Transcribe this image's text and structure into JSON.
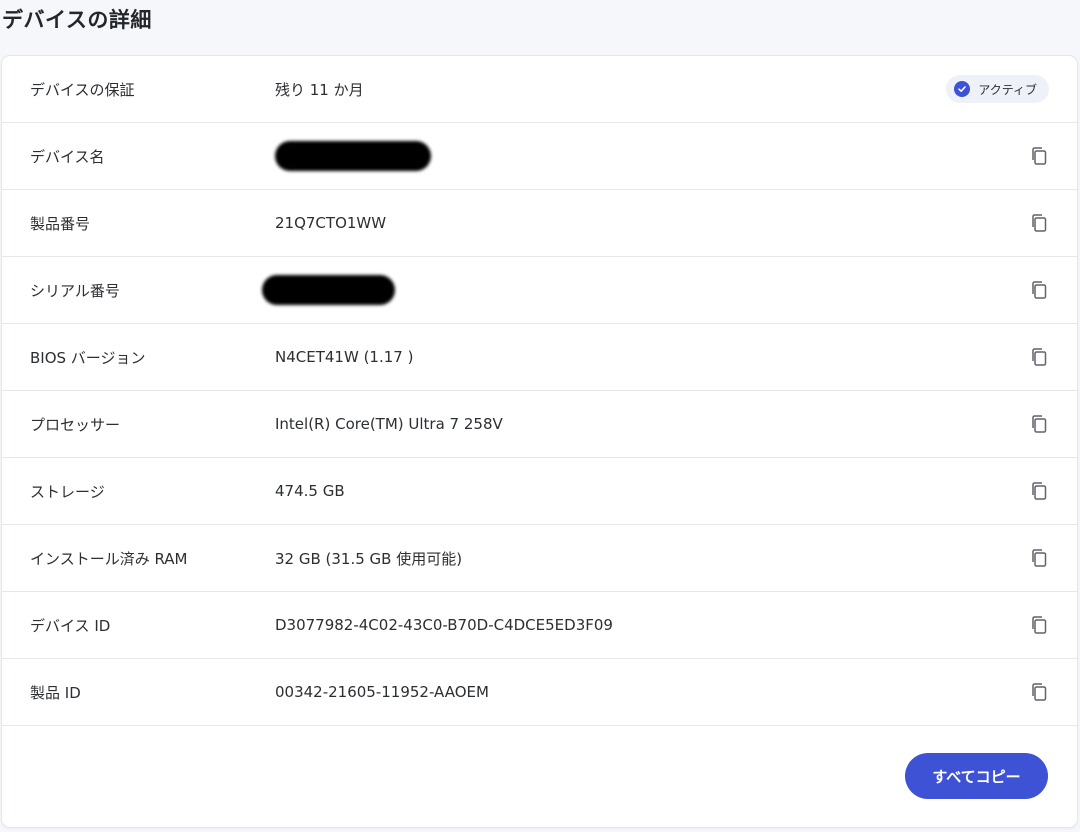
{
  "page": {
    "title": "デバイスの詳細"
  },
  "warranty": {
    "label": "デバイスの保証",
    "value": "残り 11 か月",
    "badge": "アクティブ",
    "badge_color": "#3d52d5"
  },
  "rows": [
    {
      "label": "デバイス名",
      "value": "",
      "redacted": true
    },
    {
      "label": "製品番号",
      "value": "21Q7CTO1WW"
    },
    {
      "label": "シリアル番号",
      "value": "",
      "redacted": true
    },
    {
      "label": "BIOS バージョン",
      "value": "N4CET41W (1.17 )"
    },
    {
      "label": "プロセッサー",
      "value": "Intel(R) Core(TM) Ultra 7 258V"
    },
    {
      "label": "ストレージ",
      "value": "474.5 GB"
    },
    {
      "label": "インストール済み RAM",
      "value": "32 GB (31.5 GB 使用可能)"
    },
    {
      "label": "デバイス ID",
      "value": "D3077982-4C02-43C0-B70D-C4DCE5ED3F09"
    },
    {
      "label": "製品 ID",
      "value": "00342-21605-11952-AAOEM"
    }
  ],
  "actions": {
    "copy_all_label": "すべてコピー",
    "accent_color": "#3d52d5"
  },
  "icons": {
    "copy": "copy-icon",
    "check": "check-circle-icon"
  }
}
